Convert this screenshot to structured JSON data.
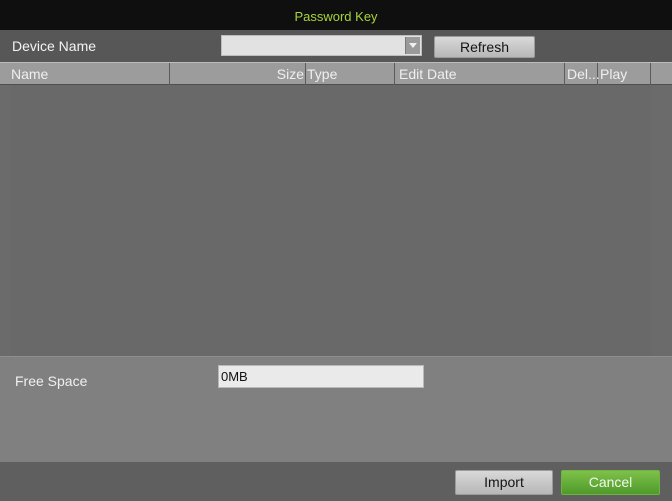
{
  "dialog": {
    "title": "Password Key"
  },
  "device": {
    "label": "Device Name",
    "selected_value": "",
    "refresh_label": "Refresh"
  },
  "table": {
    "columns": [
      "Name",
      "Size",
      "Type",
      "Edit Date",
      "Del...",
      "Play"
    ],
    "rows": []
  },
  "storage": {
    "free_space_label": "Free Space",
    "free_space_value": "0MB"
  },
  "footer": {
    "import_label": "Import",
    "cancel_label": "Cancel"
  },
  "colors": {
    "title_text": "#a6d43a",
    "cancel_button": "#5aa834"
  }
}
